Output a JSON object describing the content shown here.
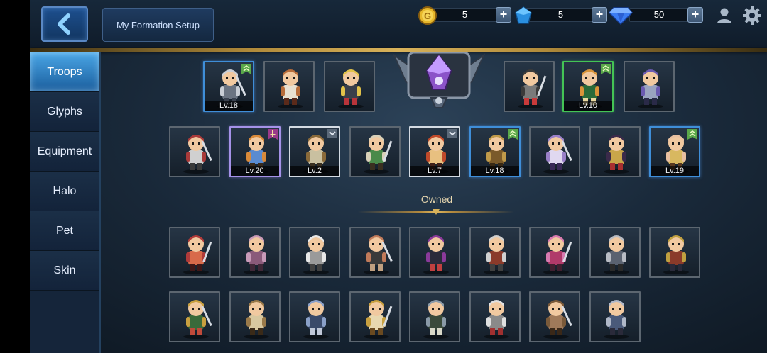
{
  "header": {
    "back_icon": "chevron-left-icon",
    "title": "My Formation Setup"
  },
  "currencies": [
    {
      "name": "gold",
      "icon": "gold-coin-icon",
      "amount": "5",
      "add": "+"
    },
    {
      "name": "crystal",
      "icon": "blue-crystal-icon",
      "amount": "5",
      "add": "+"
    },
    {
      "name": "diamond",
      "icon": "diamond-icon",
      "amount": "50",
      "add": "+"
    }
  ],
  "top_icons": [
    "profile-icon",
    "gear-icon"
  ],
  "sidebar": {
    "items": [
      {
        "label": "Troops",
        "active": true
      },
      {
        "label": "Glyphs",
        "active": false
      },
      {
        "label": "Equipment",
        "active": false
      },
      {
        "label": "Halo",
        "active": false
      },
      {
        "label": "Pet",
        "active": false
      },
      {
        "label": "Skin",
        "active": false
      }
    ]
  },
  "formation": {
    "row1": [
      {
        "level": "Lv.18",
        "frame": "blue",
        "badge": "rank-up-icon"
      },
      {
        "level": "",
        "frame": "gray"
      },
      {
        "level": "",
        "frame": "gray"
      },
      {
        "level": "",
        "frame": "gray"
      },
      {
        "level": "Lv.10",
        "frame": "green",
        "badge": "rank-up-icon"
      },
      {
        "level": "",
        "frame": "gray"
      }
    ],
    "row2": [
      {
        "level": "",
        "frame": "gray"
      },
      {
        "level": "Lv.20",
        "frame": "purple",
        "badge": "sword-badge-icon"
      },
      {
        "level": "Lv.2",
        "frame": "white",
        "badge": "chevron-badge-icon"
      },
      {
        "level": "",
        "frame": "gray"
      },
      {
        "level": "Lv.7",
        "frame": "white",
        "badge": "chevron-badge-icon"
      },
      {
        "level": "Lv.18",
        "frame": "blue",
        "badge": "rank-up-icon"
      },
      {
        "level": "",
        "frame": "gray"
      },
      {
        "level": "",
        "frame": "gray"
      },
      {
        "level": "Lv.19",
        "frame": "blue",
        "badge": "rank-up-icon"
      }
    ]
  },
  "owned": {
    "label": "Owned",
    "count_row1": 9,
    "count_row2": 8
  },
  "colors": {
    "accent_blue": "#3f8ed8",
    "gold_rule": "#d8b25a",
    "active_tab": "#4aa6e6"
  }
}
